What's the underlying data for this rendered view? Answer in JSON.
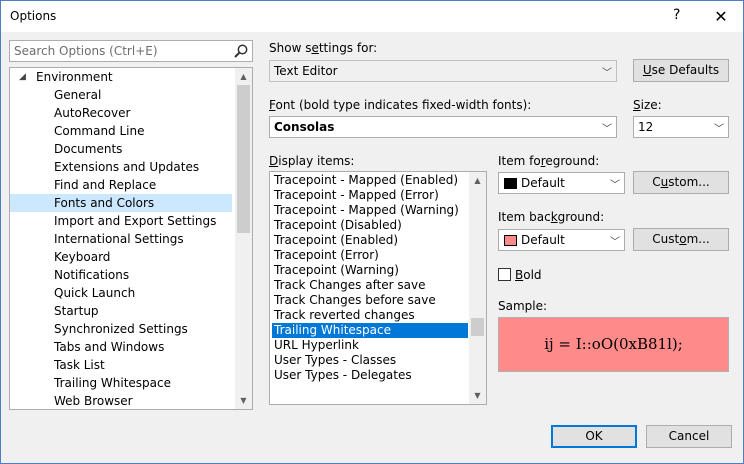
{
  "window": {
    "title": "Options",
    "help_glyph": "?",
    "close_glyph": "✕"
  },
  "search": {
    "placeholder": "Search Options (Ctrl+E)"
  },
  "tree": {
    "root": "Environment",
    "items": [
      "General",
      "AutoRecover",
      "Command Line",
      "Documents",
      "Extensions and Updates",
      "Find and Replace",
      "Fonts and Colors",
      "Import and Export Settings",
      "International Settings",
      "Keyboard",
      "Notifications",
      "Quick Launch",
      "Startup",
      "Synchronized Settings",
      "Tabs and Windows",
      "Task List",
      "Trailing Whitespace",
      "Web Browser"
    ],
    "selected": "Fonts and Colors"
  },
  "settings_for": {
    "label_pre": "Show s",
    "label_u": "e",
    "label_post": "ttings for:",
    "value": "Text Editor"
  },
  "use_defaults": {
    "label_u": "U",
    "label_post": "se Defaults"
  },
  "font": {
    "label_u": "F",
    "label_post": "ont (bold type indicates fixed-width fonts):",
    "value": "Consolas"
  },
  "size": {
    "label_u": "S",
    "label_post": "ize:",
    "value": "12"
  },
  "display_items": {
    "label_u": "D",
    "label_post": "isplay items:",
    "items": [
      "Tracepoint - Mapped (Enabled)",
      "Tracepoint - Mapped (Error)",
      "Tracepoint - Mapped (Warning)",
      "Tracepoint (Disabled)",
      "Tracepoint (Enabled)",
      "Tracepoint (Error)",
      "Tracepoint (Warning)",
      "Track Changes after save",
      "Track Changes before save",
      "Track reverted changes",
      "Trailing Whitespace",
      "URL Hyperlink",
      "User Types - Classes",
      "User Types - Delegates"
    ],
    "selected": "Trailing Whitespace"
  },
  "foreground": {
    "label_pre": "Item fo",
    "label_u": "r",
    "label_post": "eground:",
    "value": "Default",
    "color": "#000000"
  },
  "background": {
    "label_pre": "Item bac",
    "label_u": "k",
    "label_post": "ground:",
    "value": "Default",
    "color": "#ff8a8a"
  },
  "custom_buttons": {
    "fg_pre": "C",
    "fg_u": "u",
    "fg_post": "stom...",
    "bg_pre": "Cust",
    "bg_u": "o",
    "bg_post": "m..."
  },
  "bold": {
    "label_u": "B",
    "label_post": "old",
    "checked": false
  },
  "sample": {
    "label": "Sample:",
    "text": "ij = I::oO(0xB81l);"
  },
  "footer": {
    "ok": "OK",
    "cancel": "Cancel"
  },
  "colors": {
    "accent": "#0078d7",
    "selection_tree": "#cce8ff",
    "sample_bg": "#ff8a8a"
  }
}
